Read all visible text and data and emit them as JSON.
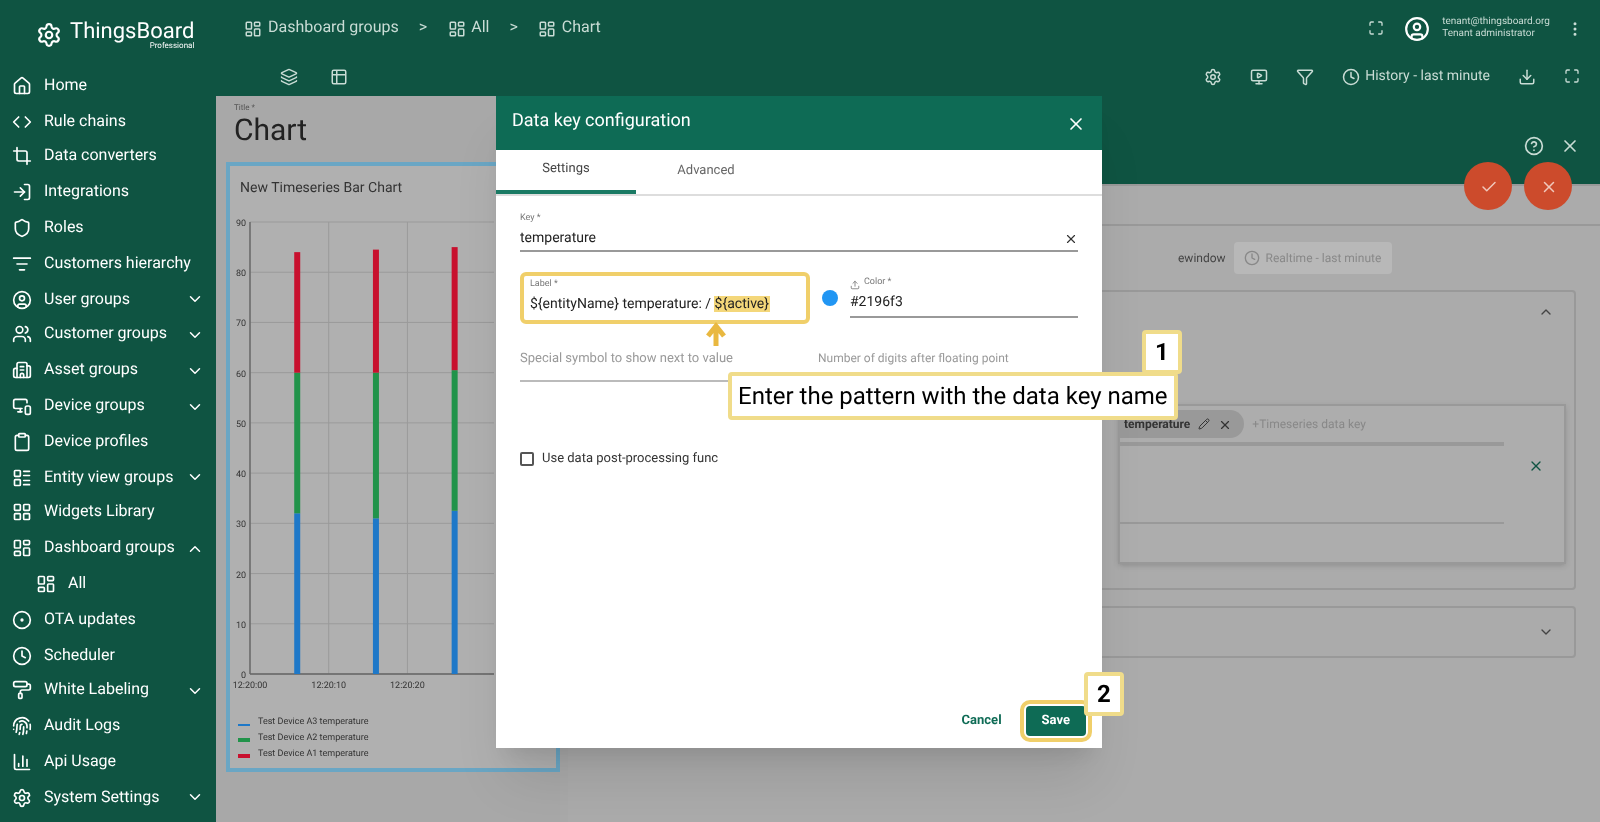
{
  "app": {
    "logo": "ThingsBoard",
    "logo_subtitle": "Professional"
  },
  "sidebar": {
    "items": [
      {
        "label": "Home",
        "kind": "link"
      },
      {
        "label": "Rule chains",
        "kind": "link"
      },
      {
        "label": "Data converters",
        "kind": "link"
      },
      {
        "label": "Integrations",
        "kind": "link"
      },
      {
        "label": "Roles",
        "kind": "link"
      },
      {
        "label": "Customers hierarchy",
        "kind": "link"
      },
      {
        "label": "User groups",
        "kind": "group",
        "expanded": false
      },
      {
        "label": "Customer groups",
        "kind": "group",
        "expanded": false
      },
      {
        "label": "Asset groups",
        "kind": "group",
        "expanded": false
      },
      {
        "label": "Device groups",
        "kind": "group",
        "expanded": false
      },
      {
        "label": "Device profiles",
        "kind": "link"
      },
      {
        "label": "Entity view groups",
        "kind": "group",
        "expanded": false
      },
      {
        "label": "Widgets Library",
        "kind": "link"
      },
      {
        "label": "Dashboard groups",
        "kind": "group",
        "expanded": true,
        "children": [
          {
            "label": "All"
          }
        ]
      },
      {
        "label": "OTA updates",
        "kind": "link"
      },
      {
        "label": "Scheduler",
        "kind": "link"
      },
      {
        "label": "White Labeling",
        "kind": "group",
        "expanded": false
      },
      {
        "label": "Audit Logs",
        "kind": "link"
      },
      {
        "label": "Api Usage",
        "kind": "link"
      },
      {
        "label": "System Settings",
        "kind": "group",
        "expanded": false
      }
    ]
  },
  "breadcrumbs": [
    {
      "label": "Dashboard groups"
    },
    {
      "label": "All"
    },
    {
      "label": "Chart"
    }
  ],
  "breadcrumb_separators": [
    ">",
    ">"
  ],
  "user": {
    "email": "tenant@thingsboard.org",
    "role": "Tenant administrator"
  },
  "toolbar": {
    "timewindow": "History - last minute"
  },
  "dashboard": {
    "title_label": "Title *",
    "title": "Chart",
    "widget": {
      "title": "New Timeseries Bar Chart",
      "chart_data": {
        "type": "bar",
        "stacked": true,
        "grid": true,
        "x": [
          44406,
          44416,
          44426
        ],
        "xlim": [
          44400,
          44431
        ],
        "ylim": [
          0,
          90
        ],
        "xticks": [
          {
            "value": 44400,
            "label": "12:20:00"
          },
          {
            "value": 44410,
            "label": "12:20:10"
          },
          {
            "value": 44420,
            "label": "12:20:20"
          }
        ],
        "yticks": [
          0,
          10,
          20,
          30,
          40,
          50,
          60,
          70,
          80,
          90
        ],
        "series": [
          {
            "name": "Test Device A3 temperature",
            "color": "#1e78c8",
            "values": [
              32,
              31,
              32.5
            ]
          },
          {
            "name": "Test Device A2 temperature",
            "color": "#21934a",
            "values": [
              28,
              29,
              28
            ]
          },
          {
            "name": "Test Device A1 temperature",
            "color": "#c8102e",
            "values": [
              24,
              24.5,
              24.5
            ]
          }
        ]
      }
    }
  },
  "editor": {
    "timewindow_label": "ewindow",
    "timewindow_button": "Realtime - last minute",
    "chip": "temperature",
    "add_key_placeholder": "+Timeseries data key"
  },
  "dialog": {
    "title": "Data key configuration",
    "tabs": [
      {
        "label": "Settings",
        "selected": true
      },
      {
        "label": "Advanced",
        "selected": false
      }
    ],
    "key": {
      "label": "Key *",
      "value": "temperature"
    },
    "label_field": {
      "label": "Label *",
      "value": "${entityName} temperature: /",
      "highlight": "${active}"
    },
    "color_field": {
      "label": "Color *",
      "value": "#2196f3",
      "color": "#2196f3"
    },
    "special_symbol": {
      "placeholder": "Special symbol to show next to value"
    },
    "digits": {
      "placeholder": "Number of digits after floating point"
    },
    "post_processing": {
      "label": "Use data post-processing func",
      "checked": false
    },
    "buttons": [
      {
        "label": "Cancel",
        "kind": "text"
      },
      {
        "label": "Save",
        "kind": "primary"
      }
    ]
  },
  "callouts": [
    {
      "number": "1",
      "text": "Enter the pattern with the data key name"
    },
    {
      "number": "2"
    }
  ]
}
